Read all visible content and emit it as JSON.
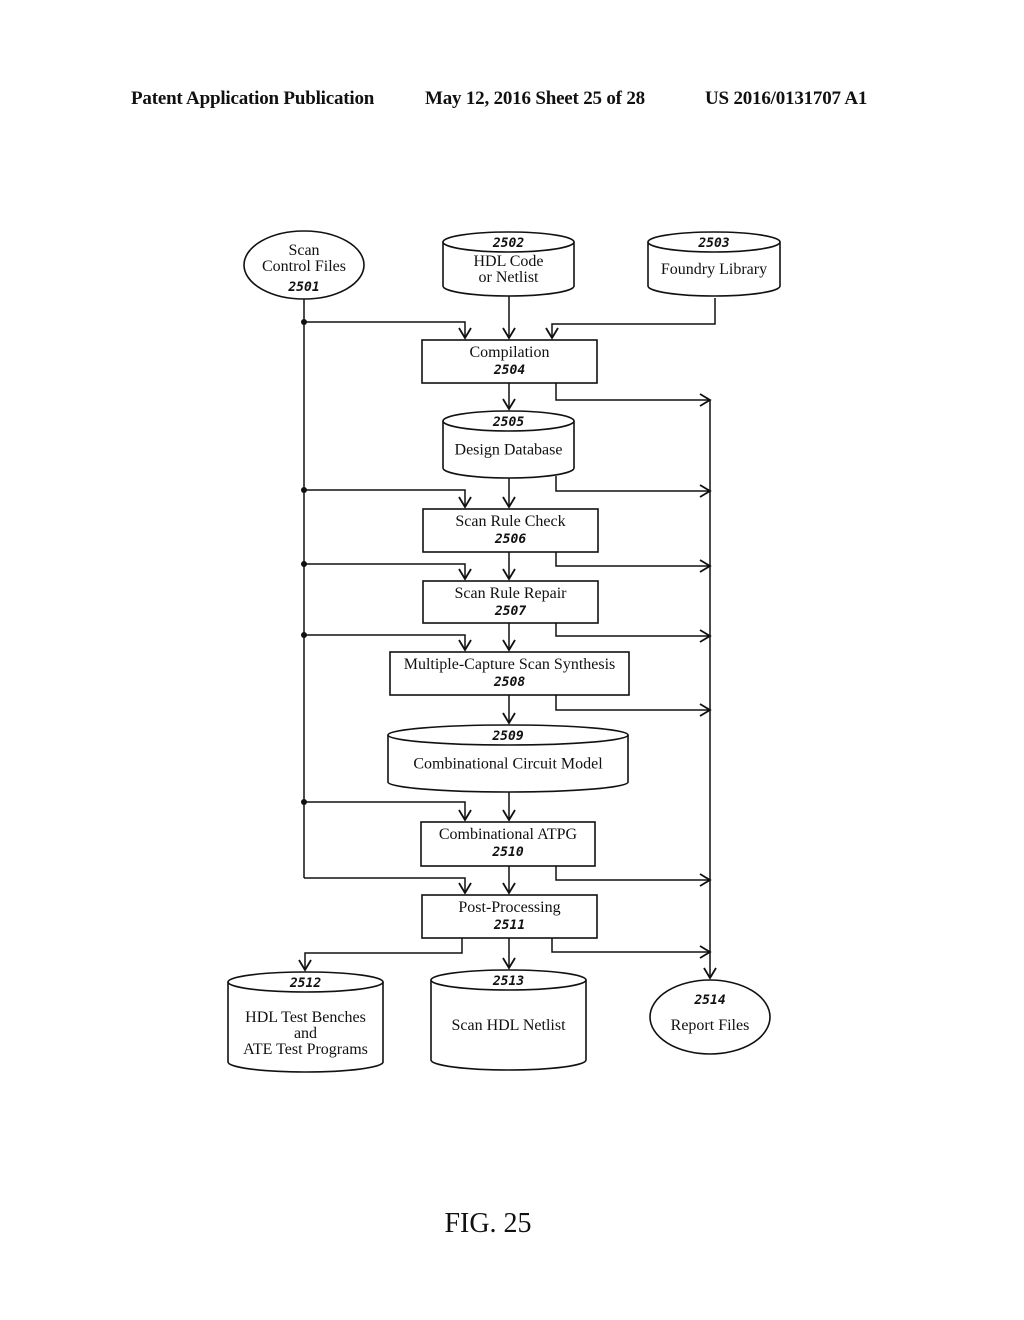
{
  "header": {
    "publication": "Patent Application Publication",
    "date_sheet": "May 12, 2016  Sheet 25 of 28",
    "number": "US 2016/0131707 A1"
  },
  "figure": {
    "caption": "FIG. 25"
  },
  "nodes": [
    {
      "id": "2501",
      "shape": "ellipse",
      "lines": [
        "Scan",
        "Control Files"
      ],
      "ref": "2501"
    },
    {
      "id": "2502",
      "shape": "cylinder",
      "lines": [
        "HDL Code",
        "or Netlist"
      ],
      "ref": "2502"
    },
    {
      "id": "2503",
      "shape": "cylinder",
      "lines": [
        "Foundry Library"
      ],
      "ref": "2503"
    },
    {
      "id": "2504",
      "shape": "rect",
      "lines": [
        "Compilation"
      ],
      "ref": "2504"
    },
    {
      "id": "2505",
      "shape": "cylinder",
      "lines": [
        "Design Database"
      ],
      "ref": "2505"
    },
    {
      "id": "2506",
      "shape": "rect",
      "lines": [
        "Scan Rule Check"
      ],
      "ref": "2506"
    },
    {
      "id": "2507",
      "shape": "rect",
      "lines": [
        "Scan Rule Repair"
      ],
      "ref": "2507"
    },
    {
      "id": "2508",
      "shape": "rect",
      "lines": [
        "Multiple-Capture Scan Synthesis"
      ],
      "ref": "2508"
    },
    {
      "id": "2509",
      "shape": "cylinder",
      "lines": [
        "Combinational Circuit Model"
      ],
      "ref": "2509"
    },
    {
      "id": "2510",
      "shape": "rect",
      "lines": [
        "Combinational ATPG"
      ],
      "ref": "2510"
    },
    {
      "id": "2511",
      "shape": "rect",
      "lines": [
        "Post-Processing"
      ],
      "ref": "2511"
    },
    {
      "id": "2512",
      "shape": "cylinder",
      "lines": [
        "HDL Test Benches",
        "and",
        "ATE Test Programs"
      ],
      "ref": "2512"
    },
    {
      "id": "2513",
      "shape": "cylinder",
      "lines": [
        "Scan HDL Netlist"
      ],
      "ref": "2513"
    },
    {
      "id": "2514",
      "shape": "ellipse",
      "lines": [
        "Report Files"
      ],
      "ref": "2514"
    }
  ],
  "edges": [
    {
      "from": "2501",
      "to": "2504"
    },
    {
      "from": "2502",
      "to": "2504"
    },
    {
      "from": "2503",
      "to": "2504"
    },
    {
      "from": "2504",
      "to": "2505"
    },
    {
      "from": "2504",
      "to": "2514"
    },
    {
      "from": "2505",
      "to": "2506"
    },
    {
      "from": "2505",
      "to": "2514"
    },
    {
      "from": "2501",
      "to": "2506"
    },
    {
      "from": "2506",
      "to": "2507"
    },
    {
      "from": "2506",
      "to": "2514"
    },
    {
      "from": "2501",
      "to": "2507"
    },
    {
      "from": "2507",
      "to": "2508"
    },
    {
      "from": "2507",
      "to": "2514"
    },
    {
      "from": "2501",
      "to": "2508"
    },
    {
      "from": "2508",
      "to": "2509"
    },
    {
      "from": "2508",
      "to": "2514"
    },
    {
      "from": "2509",
      "to": "2510"
    },
    {
      "from": "2501",
      "to": "2510"
    },
    {
      "from": "2510",
      "to": "2511"
    },
    {
      "from": "2510",
      "to": "2514"
    },
    {
      "from": "2501",
      "to": "2511"
    },
    {
      "from": "2511",
      "to": "2512"
    },
    {
      "from": "2511",
      "to": "2513"
    },
    {
      "from": "2511",
      "to": "2514"
    }
  ]
}
